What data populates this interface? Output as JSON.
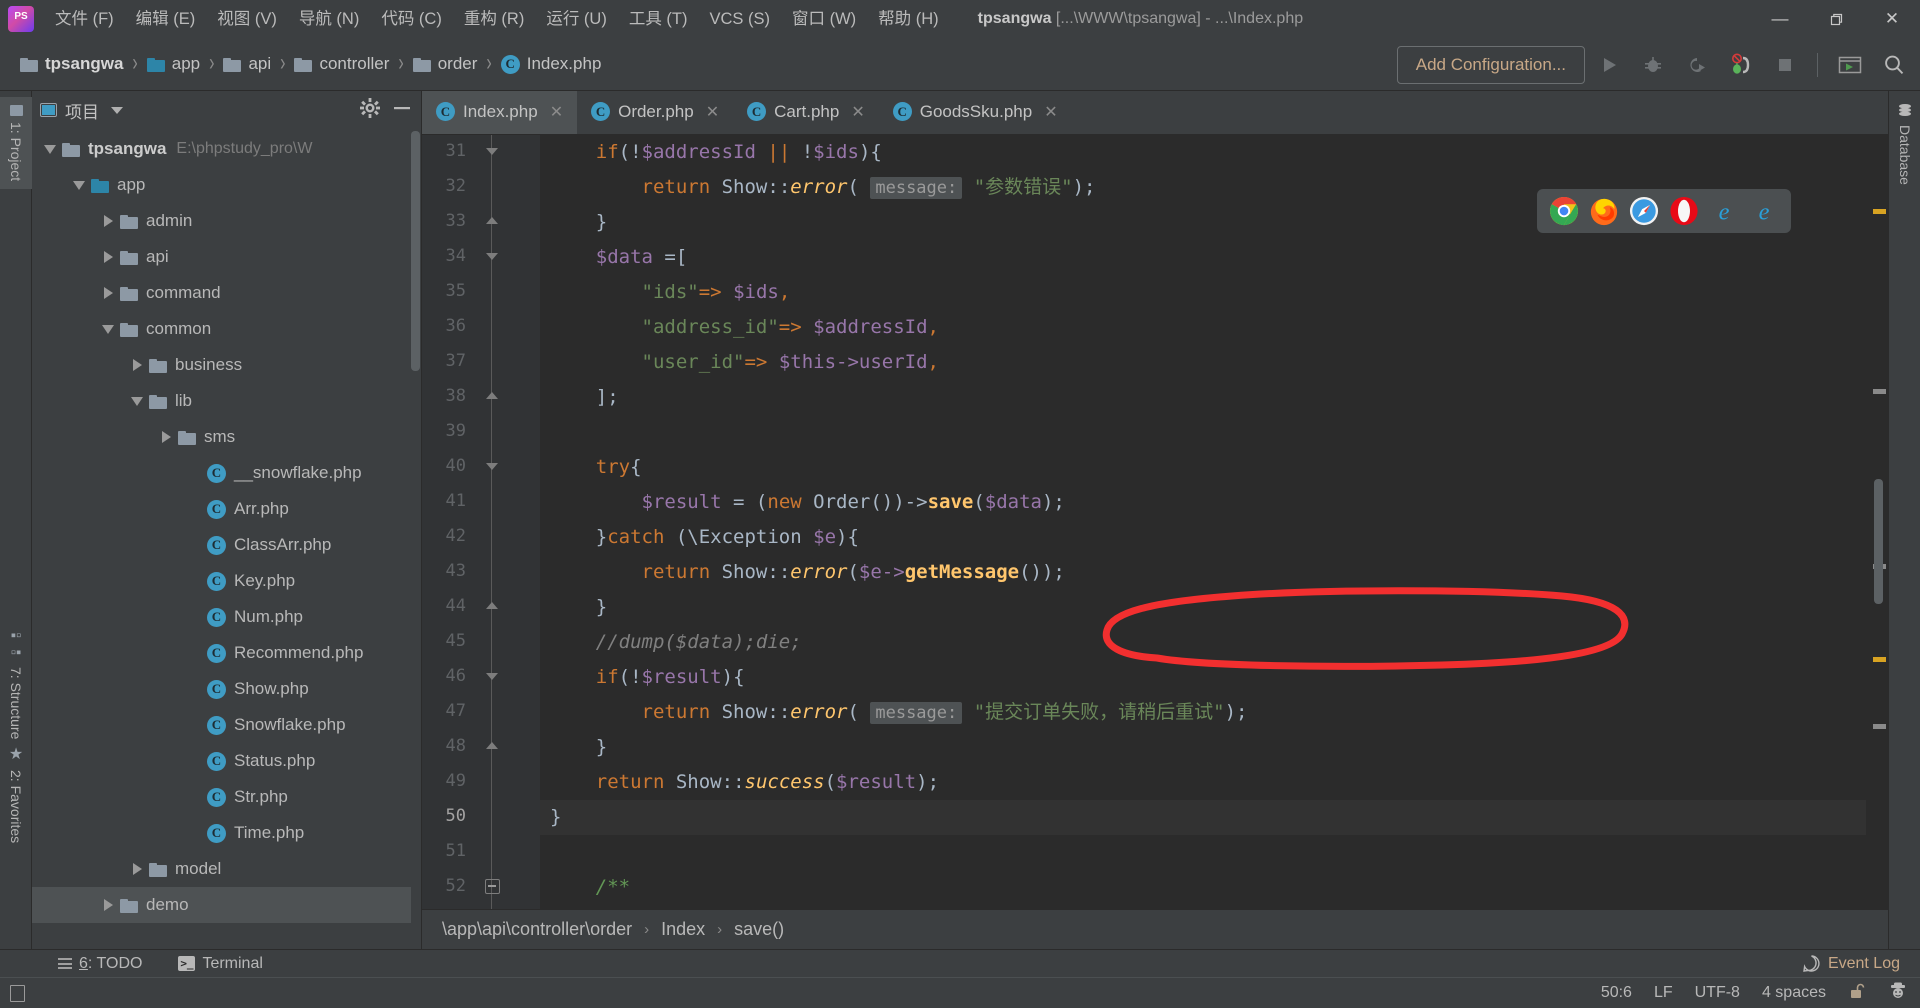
{
  "window": {
    "app_icon": "phpstorm-logo-icon",
    "title_project": "tpsangwa",
    "title_rest": " [...\\WWW\\tpsangwa] - ...\\Index.php",
    "minimize": "—",
    "maximize": "❐",
    "close": "✕"
  },
  "menubar": [
    {
      "label": "文件 (F)"
    },
    {
      "label": "编辑 (E)"
    },
    {
      "label": "视图 (V)"
    },
    {
      "label": "导航 (N)"
    },
    {
      "label": "代码 (C)"
    },
    {
      "label": "重构 (R)"
    },
    {
      "label": "运行 (U)"
    },
    {
      "label": "工具 (T)"
    },
    {
      "label": "VCS (S)"
    },
    {
      "label": "窗口 (W)"
    },
    {
      "label": "帮助 (H)"
    }
  ],
  "navbar": {
    "crumbs": [
      {
        "label": "tpsangwa",
        "icon": "folder-icon",
        "bold": true
      },
      {
        "label": "app",
        "icon": "folder-icon-blue",
        "bold": false
      },
      {
        "label": "api",
        "icon": "folder-icon",
        "bold": false
      },
      {
        "label": "controller",
        "icon": "folder-icon",
        "bold": false
      },
      {
        "label": "order",
        "icon": "folder-icon",
        "bold": false
      },
      {
        "label": "Index.php",
        "icon": "php-class-icon",
        "bold": false
      }
    ],
    "separator": "›",
    "add_configuration": "Add Configuration...",
    "buttons": [
      {
        "name": "run-button",
        "icon": "run-triangle-icon"
      },
      {
        "name": "debug-button",
        "icon": "bug-icon"
      },
      {
        "name": "run-coverage-button",
        "icon": "coverage-icon"
      },
      {
        "name": "stop-debug-button",
        "icon": "disable-breakpoints-icon"
      },
      {
        "name": "stop-button",
        "icon": "stop-square-icon"
      },
      {
        "name": "updates-button",
        "icon": "run-window-icon"
      },
      {
        "name": "search-everywhere-button",
        "icon": "search-icon"
      }
    ]
  },
  "left_strip": [
    {
      "label": "1: Project",
      "key": "1",
      "icon": "folder-icon",
      "active": true
    },
    {
      "label": "7: Structure",
      "key": "7",
      "icon": "structure-icon",
      "active": false
    },
    {
      "label": "2: Favorites",
      "key": "2",
      "icon": "star-icon",
      "active": false
    }
  ],
  "right_strip": [
    {
      "label": "Database",
      "icon": "database-icon"
    }
  ],
  "project_panel": {
    "title": "项目",
    "title_icon": "project-view-icon",
    "dropdown_icon": "chevron-down-icon",
    "settings_icon": "gear-icon",
    "hide_icon": "minimize-icon",
    "tree": [
      {
        "label": "tpsangwa",
        "detail": "E:\\phpstudy_pro\\W",
        "indent": 0,
        "arrow": "down",
        "icon": "folder",
        "bold": true
      },
      {
        "label": "app",
        "detail": "",
        "indent": 1,
        "arrow": "down",
        "icon": "folder-blue",
        "bold": false
      },
      {
        "label": "admin",
        "detail": "",
        "indent": 2,
        "arrow": "right",
        "icon": "folder",
        "bold": false
      },
      {
        "label": "api",
        "detail": "",
        "indent": 2,
        "arrow": "right",
        "icon": "folder",
        "bold": false
      },
      {
        "label": "command",
        "detail": "",
        "indent": 2,
        "arrow": "right",
        "icon": "folder",
        "bold": false
      },
      {
        "label": "common",
        "detail": "",
        "indent": 2,
        "arrow": "down",
        "icon": "folder",
        "bold": false
      },
      {
        "label": "business",
        "detail": "",
        "indent": 3,
        "arrow": "right",
        "icon": "folder",
        "bold": false
      },
      {
        "label": "lib",
        "detail": "",
        "indent": 3,
        "arrow": "down",
        "icon": "folder",
        "bold": false
      },
      {
        "label": "sms",
        "detail": "",
        "indent": 4,
        "arrow": "right",
        "icon": "folder",
        "bold": false
      },
      {
        "label": "__snowflake.php",
        "detail": "",
        "indent": 5,
        "arrow": "none",
        "icon": "php",
        "bold": false
      },
      {
        "label": "Arr.php",
        "detail": "",
        "indent": 5,
        "arrow": "none",
        "icon": "php",
        "bold": false
      },
      {
        "label": "ClassArr.php",
        "detail": "",
        "indent": 5,
        "arrow": "none",
        "icon": "php",
        "bold": false
      },
      {
        "label": "Key.php",
        "detail": "",
        "indent": 5,
        "arrow": "none",
        "icon": "php",
        "bold": false
      },
      {
        "label": "Num.php",
        "detail": "",
        "indent": 5,
        "arrow": "none",
        "icon": "php",
        "bold": false
      },
      {
        "label": "Recommend.php",
        "detail": "",
        "indent": 5,
        "arrow": "none",
        "icon": "php",
        "bold": false
      },
      {
        "label": "Show.php",
        "detail": "",
        "indent": 5,
        "arrow": "none",
        "icon": "php",
        "bold": false
      },
      {
        "label": "Snowflake.php",
        "detail": "",
        "indent": 5,
        "arrow": "none",
        "icon": "php",
        "bold": false
      },
      {
        "label": "Status.php",
        "detail": "",
        "indent": 5,
        "arrow": "none",
        "icon": "php",
        "bold": false
      },
      {
        "label": "Str.php",
        "detail": "",
        "indent": 5,
        "arrow": "none",
        "icon": "php",
        "bold": false
      },
      {
        "label": "Time.php",
        "detail": "",
        "indent": 5,
        "arrow": "none",
        "icon": "php",
        "bold": false
      },
      {
        "label": "model",
        "detail": "",
        "indent": 3,
        "arrow": "right",
        "icon": "folder",
        "bold": false
      },
      {
        "label": "demo",
        "detail": "",
        "indent": 2,
        "arrow": "right",
        "icon": "folder",
        "bold": false,
        "selected": true
      }
    ]
  },
  "editor": {
    "tabs": [
      {
        "label": "Index.php",
        "icon": "php-class-icon",
        "active": true,
        "close": "✕"
      },
      {
        "label": "Order.php",
        "icon": "php-class-icon",
        "active": false,
        "close": "✕"
      },
      {
        "label": "Cart.php",
        "icon": "php-class-icon",
        "active": false,
        "close": "✕"
      },
      {
        "label": "GoodsSku.php",
        "icon": "php-class-icon",
        "active": false,
        "close": "✕"
      }
    ],
    "first_line_number": 31,
    "current_line": 50,
    "lines": [
      {
        "n": 31,
        "fold": "tri-down"
      },
      {
        "n": 32,
        "fold": "none"
      },
      {
        "n": 33,
        "fold": "tri-up"
      },
      {
        "n": 34,
        "fold": "tri-down"
      },
      {
        "n": 35,
        "fold": "none"
      },
      {
        "n": 36,
        "fold": "none"
      },
      {
        "n": 37,
        "fold": "none"
      },
      {
        "n": 38,
        "fold": "tri-up"
      },
      {
        "n": 39,
        "fold": "none"
      },
      {
        "n": 40,
        "fold": "tri-down"
      },
      {
        "n": 41,
        "fold": "none"
      },
      {
        "n": 42,
        "fold": "none"
      },
      {
        "n": 43,
        "fold": "none"
      },
      {
        "n": 44,
        "fold": "tri-up"
      },
      {
        "n": 45,
        "fold": "none"
      },
      {
        "n": 46,
        "fold": "tri-down"
      },
      {
        "n": 47,
        "fold": "none"
      },
      {
        "n": 48,
        "fold": "tri-up"
      },
      {
        "n": 49,
        "fold": "none"
      },
      {
        "n": 50,
        "fold": "none"
      },
      {
        "n": 51,
        "fold": "none"
      },
      {
        "n": 52,
        "fold": "close"
      }
    ],
    "code_text": [
      "    if(!$addressId || !$ids){",
      "        return Show::error( message: \"参数错误\");",
      "    }",
      "    $data =[",
      "        \"ids\"=> $ids,",
      "        \"address_id\"=> $addressId,",
      "        \"user_id\"=> $this->userId,",
      "    ];",
      "",
      "    try{",
      "        $result = (new Order())->save($data);",
      "    }catch (\\Exception $e){",
      "        return Show::error($e->getMessage());",
      "    }",
      "    //dump($data);die;",
      "    if(!$result){",
      "        return Show::error( message: \"提交订单失败，请稍后重试\");",
      "    }",
      "    return Show::success($result);",
      "}",
      "",
      "    /**"
    ],
    "annotation": {
      "type": "red-ellipse",
      "color": "#f22f2f",
      "target_line": 41,
      "target_text": "$result = (new Order())->save($data);"
    },
    "browser_popup": [
      {
        "name": "chrome-icon"
      },
      {
        "name": "firefox-icon"
      },
      {
        "name": "safari-icon"
      },
      {
        "name": "opera-icon"
      },
      {
        "name": "internet-explorer-icon"
      },
      {
        "name": "edge-icon"
      }
    ]
  },
  "editor_breadcrumb": {
    "segments": [
      "\\app\\api\\controller\\order",
      "Index",
      "save()"
    ],
    "separator": "›"
  },
  "bottom_bar": {
    "todo": {
      "key": "6",
      "label": ": TODO",
      "icon": "todo-list-icon"
    },
    "terminal": {
      "label": "Terminal",
      "icon": "terminal-icon"
    },
    "event_log": {
      "label": "Event Log",
      "icon": "event-log-icon"
    }
  },
  "status_bar": {
    "caret": "50:6",
    "line_separator": "LF",
    "encoding": "UTF-8",
    "indent": "4 spaces",
    "lock_icon": "unlock-icon",
    "user_icon": "hector-inspector-icon"
  },
  "colors": {
    "bg_chrome": "#3c3f41",
    "bg_editor": "#2b2b2b",
    "bg_gutter": "#313335",
    "accent_blue": "#3f9cc4",
    "accent_orange": "#c8a887",
    "annotation_red": "#f22f2f",
    "keyword": "#cc7832",
    "variable": "#9876aa",
    "string": "#6a8759",
    "function": "#ffc66d",
    "comment": "#808080",
    "doc_comment": "#629755",
    "default_text": "#a9b7c6"
  }
}
